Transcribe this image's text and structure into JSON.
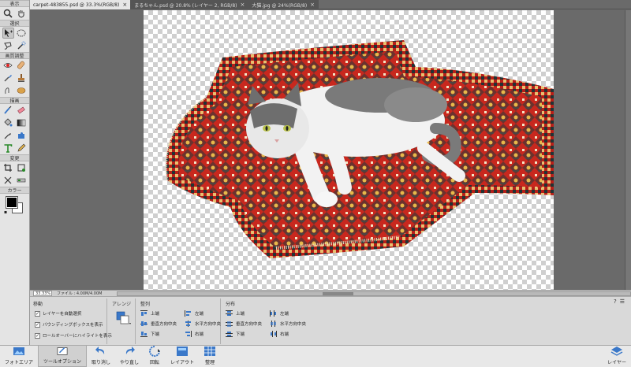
{
  "tabs": [
    {
      "label": "carpet-483855.psd @ 33.3%(RGB/8)",
      "active": true
    },
    {
      "label": "まるちゃん.psd @ 20.8% (レイヤー 2, RGB/8)",
      "active": false
    },
    {
      "label": "大猫.jpg @ 24%(RGB/8)",
      "active": false
    }
  ],
  "tab_close": "×",
  "toolbox": {
    "view_label": "表示",
    "select_label": "選択",
    "enhance_label": "画質調整",
    "draw_label": "描画",
    "modify_label": "変更",
    "color_label": "カラー"
  },
  "status": {
    "zoom": "33.33%",
    "doc_info": "ファイル : 4.00M/4.00M"
  },
  "options": {
    "move_title": "移動",
    "auto_select": "レイヤーを自動選択",
    "show_bbox": "バウンディングボックスを表示",
    "rollover": "ロールオーバーにハイライトを表示",
    "arrange_title": "アレンジ",
    "align_title": "整列",
    "align": [
      "上端",
      "左端",
      "垂直方向中央",
      "水平方向中央",
      "下端",
      "右端"
    ],
    "distribute_title": "分布",
    "distribute": [
      "上端",
      "左端",
      "垂直方向中央",
      "水平方向中央",
      "下端",
      "右端"
    ],
    "help": "?"
  },
  "taskbar": {
    "photo_area": "フォトエリア",
    "tool_options": "ツールオプション",
    "undo": "取り消し",
    "redo": "やり直し",
    "rotate": "回転",
    "layout": "レイアウト",
    "organize": "整理",
    "layers": "レイヤー"
  },
  "colors": {
    "foreground": "#000000",
    "background": "#ffffff",
    "carpet_red": "#c8281e",
    "carpet_dark": "#1e3a3a"
  }
}
